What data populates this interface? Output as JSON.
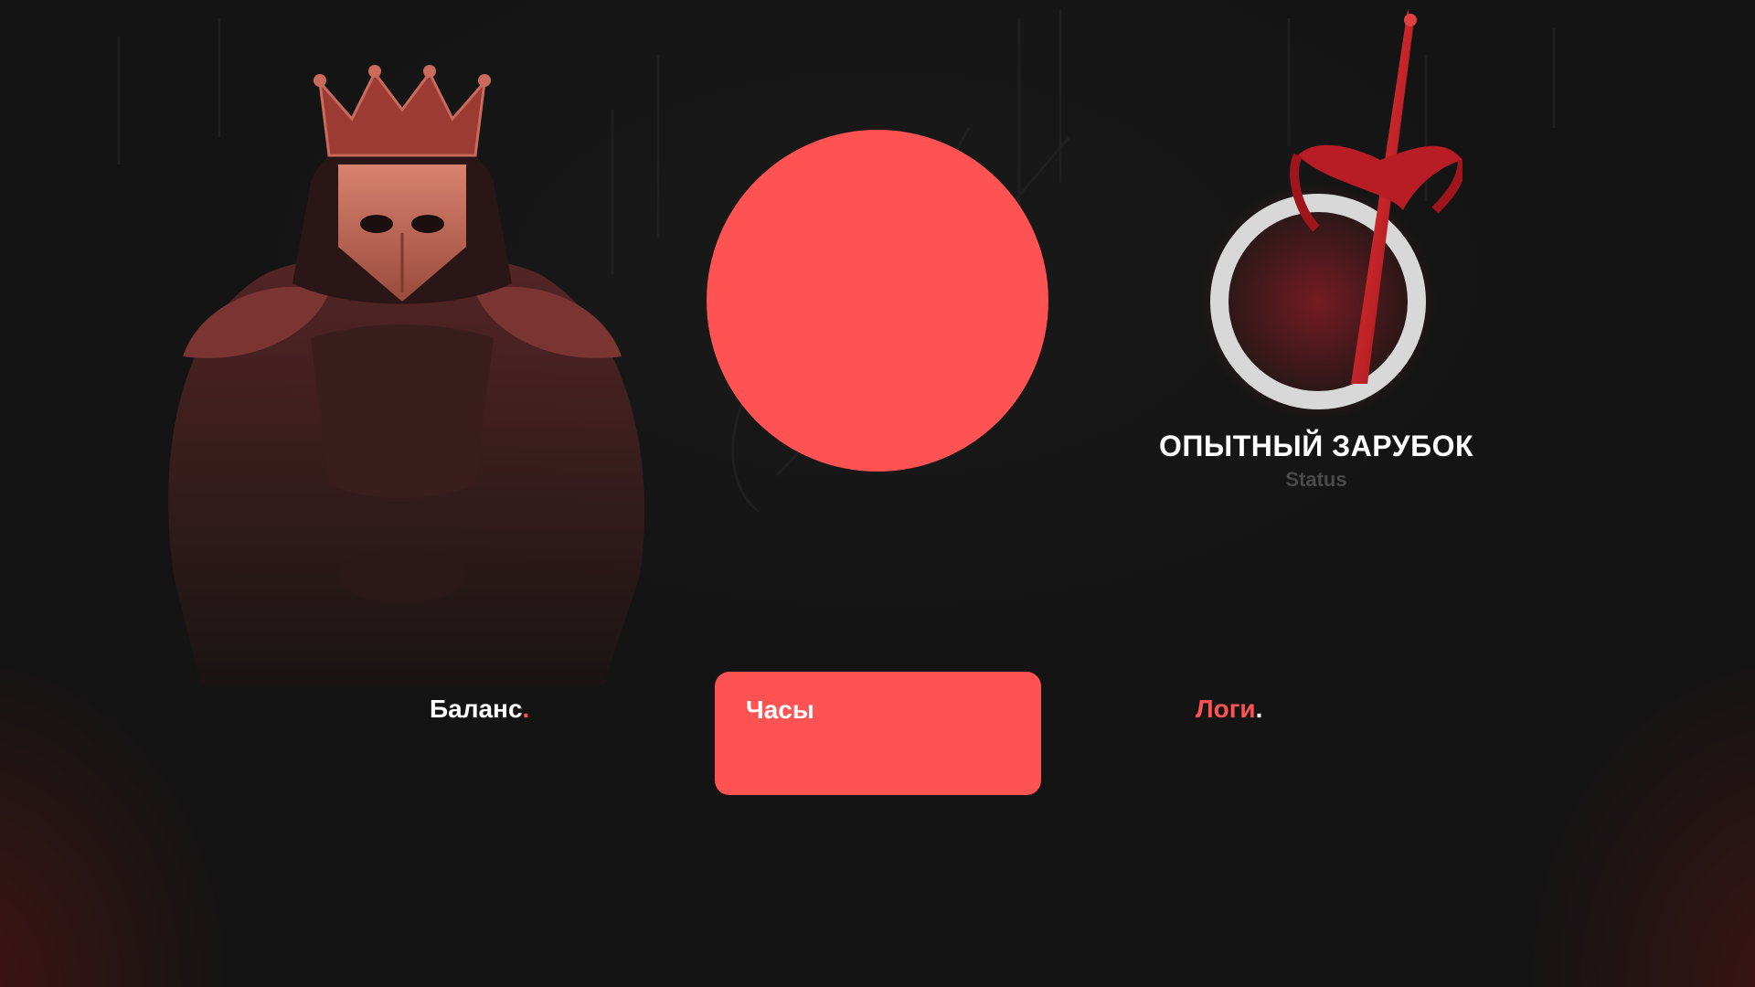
{
  "colors": {
    "accent": "#ff5252",
    "background": "#141414",
    "text_primary": "#ffffff",
    "text_muted": "#4a4a4a"
  },
  "status": {
    "title": "ОПЫТНЫЙ ЗАРУБОК",
    "subtitle": "Status",
    "emblem_icon": "sword-ring-icon"
  },
  "profile": {
    "avatar_icon": "avatar-placeholder",
    "character_icon": "crowned-knight-illustration"
  },
  "tabs": {
    "balance": {
      "label": "Баланс",
      "dot": "."
    },
    "hours": {
      "label": "Часы"
    },
    "logs": {
      "label": "Логи",
      "dot": "."
    }
  }
}
